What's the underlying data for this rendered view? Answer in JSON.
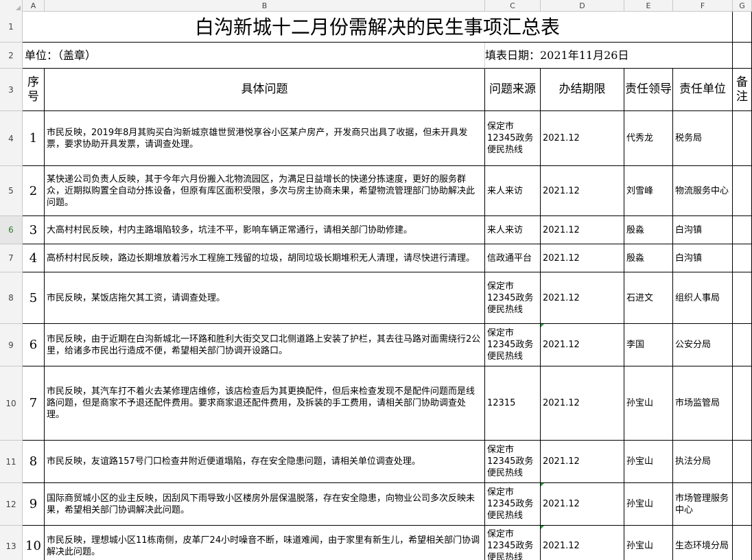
{
  "columns": [
    "A",
    "B",
    "C",
    "D",
    "E",
    "F",
    "G"
  ],
  "title": "白沟新城十二月份需解决的民生事项汇总表",
  "unit_label": "单位：（盖章）",
  "date_label": "填表日期：2021年11月26日",
  "headers": {
    "seq": "序号",
    "issue": "具体问题",
    "source": "问题来源",
    "deadline": "办结期限",
    "leader": "责任领导",
    "dept": "责任单位",
    "note": "备注"
  },
  "row_numbers": [
    "1",
    "2",
    "3",
    "4",
    "5",
    "6",
    "7",
    "8",
    "9",
    "10",
    "11",
    "12",
    "13"
  ],
  "selected_row": "6",
  "rows": [
    {
      "seq": "1",
      "issue": "市民反映，2019年8月其购买白沟新城京雄世贸港悦享谷小区某户房产，开发商只出具了收据，但未开具发票，要求协助开具发票，请调查处理。",
      "source": "保定市12345政务便民热线",
      "deadline": "2021.12",
      "leader": "代秀龙",
      "dept": "税务局",
      "note": ""
    },
    {
      "seq": "2",
      "issue": "某快递公司负责人反映，其于今年六月份搬入北物流园区，为满足日益增长的快递分拣速度，更好的服务群众，近期拟购置全自动分拣设备，但原有库区面积受限，多次与房主协商未果，希望物流管理部门协助解决此问题。",
      "source": "来人来访",
      "deadline": "2021.12",
      "leader": "刘雪峰",
      "dept": "物流服务中心",
      "note": ""
    },
    {
      "seq": "3",
      "issue": "大高村村民反映，村内主路塌陷较多，坑洼不平，影响车辆正常通行，请相关部门协助修建。",
      "source": "来人来访",
      "deadline": "2021.12",
      "leader": "殷淼",
      "dept": "白沟镇",
      "note": ""
    },
    {
      "seq": "4",
      "issue": "高桥村村民反映，路边长期堆放着污水工程施工残留的垃圾，胡同垃圾长期堆积无人清理，请尽快进行清理。",
      "source": "信政通平台",
      "deadline": "2021.12",
      "leader": "殷淼",
      "dept": "白沟镇",
      "note": ""
    },
    {
      "seq": "5",
      "issue": "市民反映，某饭店拖欠其工资，请调查处理。",
      "source": "保定市12345政务便民热线",
      "deadline": "2021.12",
      "leader": "石进文",
      "dept": "组织人事局",
      "note": ""
    },
    {
      "seq": "6",
      "issue": "市民反映，由于近期在白沟新城北一环路和胜利大街交叉口北侧道路上安装了护栏，其去往马路对面需绕行2公里，给诸多市民出行造成不便，希望相关部门协调开设路口。",
      "source": "保定市12345政务便民热线",
      "deadline": "2021.12",
      "leader": "李国",
      "dept": "公安分局",
      "note": ""
    },
    {
      "seq": "7",
      "issue": "市民反映，其汽车打不着火去某修理店维修，该店检查后为其更换配件，但后来检查发现不是配件问题而是线路问题，但是商家不予退还配件费用。要求商家退还配件费用，及拆装的手工费用，请相关部门协助调查处理。",
      "source": "12315",
      "deadline": "2021.12",
      "leader": "孙宝山",
      "dept": "市场监管局",
      "note": ""
    },
    {
      "seq": "8",
      "issue": "市民反映，友谊路157号门口检查井附近便道塌陷，存在安全隐患问题，请相关单位调查处理。",
      "source": "保定市12345政务便民热线",
      "deadline": "2021.12",
      "leader": "孙宝山",
      "dept": "执法分局",
      "note": ""
    },
    {
      "seq": "9",
      "issue": "国际商贸城小区的业主反映，因刮风下雨导致小区楼房外层保温脱落，存在安全隐患，向物业公司多次反映未果，希望相关部门协调解决此问题。",
      "source": "保定市12345政务便民热线",
      "deadline": "2021.12",
      "leader": "孙宝山",
      "dept": "市场管理服务中心",
      "note": ""
    },
    {
      "seq": "10",
      "issue": "市民反映，理想城小区11栋南侧，皮革厂24小时噪音不断，味道难闻，由于家里有新生儿，希望相关部门协调解决此问题。",
      "source": "保定市12345政务便民热线",
      "deadline": "2021.12",
      "leader": "孙宝山",
      "dept": "生态环境分局",
      "note": ""
    }
  ]
}
